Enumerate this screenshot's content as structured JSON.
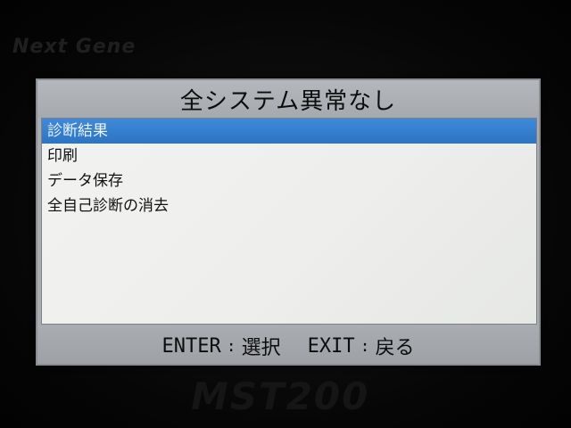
{
  "device": {
    "brand_text": "Next Gene",
    "model_text": "MST200"
  },
  "screen": {
    "title": "全システム異常なし",
    "menu_items": [
      {
        "label": "診断結果",
        "selected": true
      },
      {
        "label": "印刷",
        "selected": false
      },
      {
        "label": "データ保存",
        "selected": false
      },
      {
        "label": "全自己診断の消去",
        "selected": false
      }
    ],
    "footer": {
      "enter_key": "ENTER",
      "enter_action": "選択",
      "exit_key": "EXIT",
      "exit_action": "戻る",
      "separator": ":"
    }
  },
  "colors": {
    "selection": "#2f78c8",
    "panel": "#efefed",
    "frame": "#a9adb1"
  }
}
